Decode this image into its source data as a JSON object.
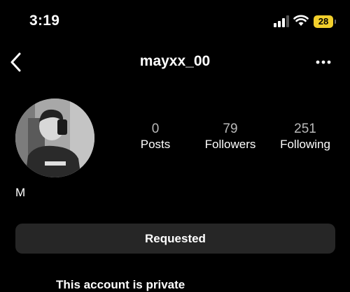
{
  "status_bar": {
    "time": "3:19",
    "battery": "28",
    "battery_color": "#f2cf2c",
    "icons": [
      "signal-icon",
      "wifi-icon",
      "battery-icon"
    ]
  },
  "nav": {
    "back_icon": "chevron-left-icon",
    "username": "mayxx_00",
    "more_icon": "more-horizontal-icon"
  },
  "profile": {
    "display_name": "M",
    "stats": [
      {
        "value": "0",
        "label": "Posts"
      },
      {
        "value": "79",
        "label": "Followers"
      },
      {
        "value": "251",
        "label": "Following"
      }
    ]
  },
  "actions": {
    "requested_label": "Requested"
  },
  "private_notice": {
    "text": "This account is private"
  }
}
